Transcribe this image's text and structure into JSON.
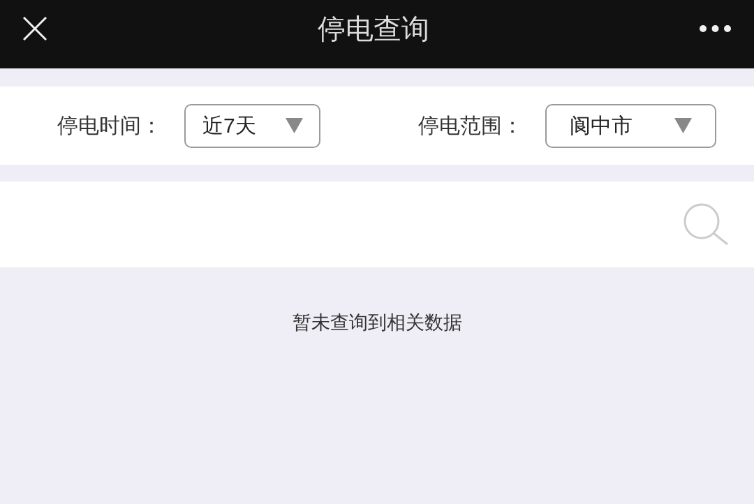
{
  "header": {
    "title": "停电查询"
  },
  "filters": [
    {
      "label": "停电时间：",
      "value": "近7天"
    },
    {
      "label": "停电范围：",
      "value": "阆中市"
    }
  ],
  "empty_message": "暂未查询到相关数据"
}
